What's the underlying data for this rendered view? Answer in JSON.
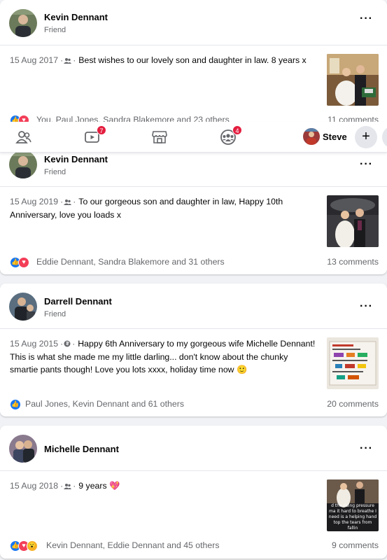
{
  "posts": [
    {
      "author": "Kevin Dennant",
      "relation": "Friend",
      "date": "15 Aug 2017",
      "audience": "friends",
      "text": "Best wishes to our lovely son and daughter in law. 8 years x",
      "reactors": "You, Paul Jones, Sandra Blakemore and 23 others",
      "comments": "11 comments",
      "reactions": [
        "like",
        "love"
      ]
    },
    {
      "author": "Kevin Dennant",
      "relation": "Friend",
      "date": "15 Aug 2019",
      "audience": "friends",
      "text": "To our gorgeous son and daughter in law, Happy 10th Anniversary, love you loads x",
      "reactors": "Eddie Dennant, Sandra Blakemore and 31 others",
      "comments": "13 comments",
      "reactions": [
        "like",
        "love"
      ]
    },
    {
      "author": "Darrell Dennant",
      "relation": "Friend",
      "date": "15 Aug 2015",
      "audience": "public",
      "text": "Happy 6th Anniversary to my gorgeous wife Michelle Dennant! This is what she made me my little darling... don't know about the chunky smartie pants though! Love you lots xxxx, holiday time now 🙂",
      "reactors": "Paul Jones, Kevin Dennant and 61 others",
      "comments": "20 comments",
      "reactions": [
        "like"
      ]
    },
    {
      "author": "Michelle Dennant",
      "relation": "",
      "date": "15 Aug 2018",
      "audience": "friends",
      "text": "9 years 💖",
      "reactors": "Kevin Dennant, Eddie Dennant and 45 others",
      "comments": "9 comments",
      "reactions": [
        "like",
        "love",
        "wow"
      ],
      "photo_caption": "d the rising pressure ma it hard to breathe I need is a helping hand top the tears from fallin"
    }
  ],
  "nav": {
    "items": [
      "friends-icon",
      "watch-icon",
      "marketplace-icon",
      "groups-icon"
    ],
    "watch_badge": "7",
    "groups_badge": "4",
    "profile_name": "Steve",
    "plus_label": "+"
  },
  "separator": "·",
  "more_label": "···",
  "colors": {
    "accent": "#1877f2",
    "badge": "#e41e3f",
    "love": "#f33e58"
  }
}
